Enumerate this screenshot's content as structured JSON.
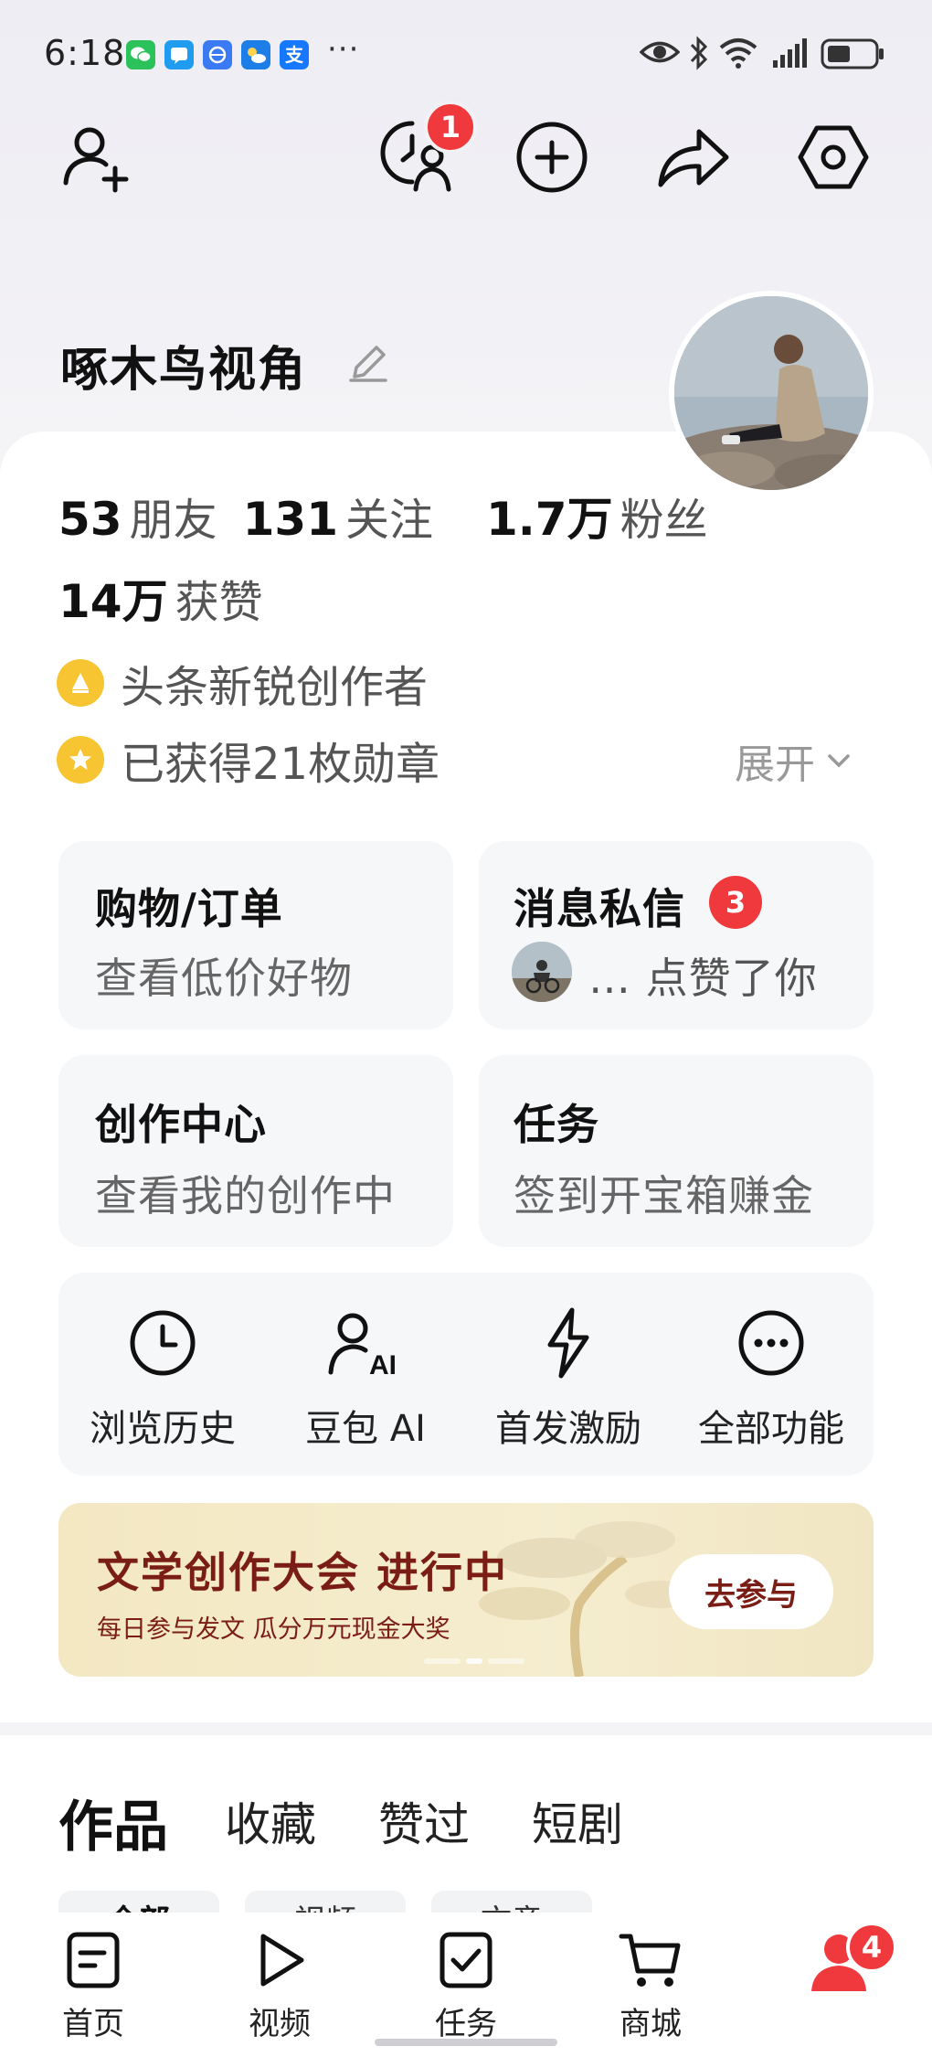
{
  "status_bar": {
    "time": "6:18",
    "more": "···",
    "apps": [
      "wechat-icon",
      "messages-icon",
      "browser-icon",
      "weather-icon",
      "alipay-icon"
    ],
    "alipay_glyph": "支"
  },
  "top_bar": {
    "message_badge": "1"
  },
  "profile": {
    "username": "啄木鸟视角",
    "stats": [
      {
        "value": "53",
        "label": "朋友"
      },
      {
        "value": "131",
        "label": "关注"
      },
      {
        "value": "1.7万",
        "label": "粉丝"
      }
    ],
    "likes": {
      "value": "14万",
      "label": "获赞"
    },
    "creator_title": "头条新锐创作者",
    "badges_text": "已获得21枚勋章",
    "expand_label": "展开"
  },
  "tiles": {
    "shopping": {
      "title": "购物/订单",
      "subtitle": "查看低价好物"
    },
    "messages": {
      "title": "消息私信",
      "badge": "3",
      "preview": "… 点赞了你"
    },
    "creation": {
      "title": "创作中心",
      "subtitle": "查看我的创作中"
    },
    "tasks": {
      "title": "任务",
      "subtitle": "签到开宝箱赚金"
    }
  },
  "features": [
    {
      "label": "浏览历史",
      "icon": "clock-icon"
    },
    {
      "label": "豆包 AI",
      "icon": "doubao-ai-icon"
    },
    {
      "label": "首发激励",
      "icon": "lightning-icon"
    },
    {
      "label": "全部功能",
      "icon": "more-icon"
    }
  ],
  "banner": {
    "title": "文学创作大会 进行中",
    "subtitle": "每日参与发文 瓜分万元现金大奖",
    "button": "去参与"
  },
  "content_tabs": [
    "作品",
    "收藏",
    "赞过",
    "短剧"
  ],
  "filter_chips": [
    "全部",
    "视频",
    "文章"
  ],
  "bottom_nav": [
    {
      "label": "首页",
      "icon": "home-doc-icon"
    },
    {
      "label": "视频",
      "icon": "play-icon"
    },
    {
      "label": "任务",
      "icon": "task-check-icon"
    },
    {
      "label": "商城",
      "icon": "cart-icon"
    }
  ],
  "profile_nav_badge": "4",
  "colors": {
    "accent_red": "#f0393d",
    "banner_text": "#7a1d14",
    "coin_yellow": "#f7c531"
  }
}
